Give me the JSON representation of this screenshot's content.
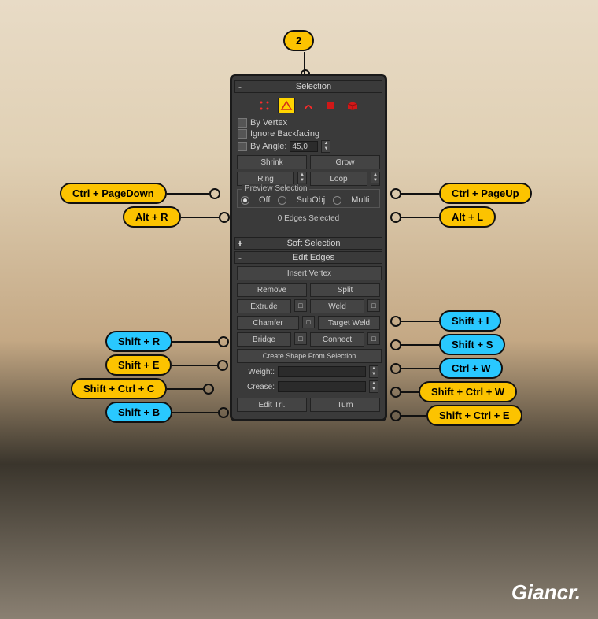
{
  "top_callout": "2",
  "panel": {
    "rollouts": {
      "selection": {
        "toggle": "-",
        "title": "Selection"
      },
      "soft": {
        "toggle": "+",
        "title": "Soft Selection"
      },
      "edges": {
        "toggle": "-",
        "title": "Edit Edges"
      }
    },
    "checks": {
      "by_vertex": "By Vertex",
      "ignore_backfacing": "Ignore Backfacing",
      "by_angle": "By Angle:",
      "by_angle_value": "45,0"
    },
    "buttons": {
      "shrink": "Shrink",
      "grow": "Grow",
      "ring": "Ring",
      "loop": "Loop",
      "insert_vertex": "Insert Vertex",
      "remove": "Remove",
      "split": "Split",
      "extrude": "Extrude",
      "weld": "Weld",
      "chamfer": "Chamfer",
      "target_weld": "Target Weld",
      "bridge": "Bridge",
      "connect": "Connect",
      "create_shape": "Create Shape From Selection",
      "edit_tri": "Edit Tri.",
      "turn": "Turn"
    },
    "preview": {
      "label": "Preview Selection",
      "off": "Off",
      "subobj": "SubObj",
      "multi": "Multi"
    },
    "status": "0 Edges Selected",
    "fields": {
      "weight": "Weight:",
      "crease": "Crease:"
    }
  },
  "callouts": {
    "left": [
      {
        "label": "Ctrl + PageDown",
        "color": "yellow"
      },
      {
        "label": "Alt + R",
        "color": "yellow"
      },
      {
        "label": "Shift + R",
        "color": "blue"
      },
      {
        "label": "Shift + E",
        "color": "yellow"
      },
      {
        "label": "Shift + Ctrl + C",
        "color": "yellow"
      },
      {
        "label": "Shift + B",
        "color": "blue"
      }
    ],
    "right": [
      {
        "label": "Ctrl + PageUp",
        "color": "yellow"
      },
      {
        "label": "Alt + L",
        "color": "yellow"
      },
      {
        "label": "Shift + I",
        "color": "blue"
      },
      {
        "label": "Shift + S",
        "color": "blue"
      },
      {
        "label": "Ctrl + W",
        "color": "blue"
      },
      {
        "label": "Shift + Ctrl + W",
        "color": "yellow"
      },
      {
        "label": "Shift + Ctrl + E",
        "color": "yellow"
      }
    ]
  },
  "brand": "Giancr."
}
